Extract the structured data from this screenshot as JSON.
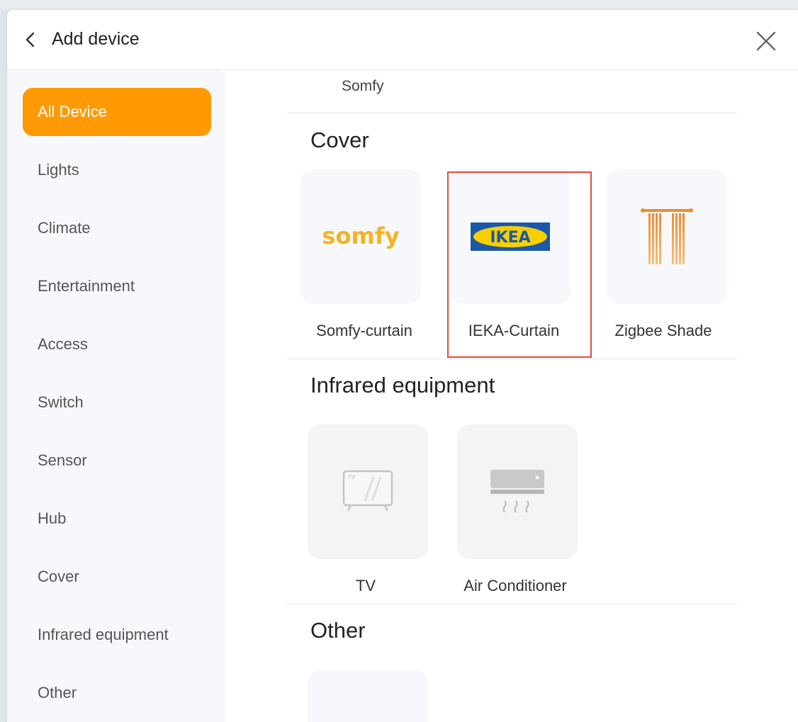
{
  "dialog": {
    "title": "Add device"
  },
  "sidebar": {
    "items": [
      {
        "label": "All Device",
        "active": true
      },
      {
        "label": "Lights"
      },
      {
        "label": "Climate"
      },
      {
        "label": "Entertainment"
      },
      {
        "label": "Access"
      },
      {
        "label": "Switch"
      },
      {
        "label": "Sensor"
      },
      {
        "label": "Hub"
      },
      {
        "label": "Cover"
      },
      {
        "label": "Infrared equipment"
      },
      {
        "label": "Other"
      }
    ]
  },
  "content": {
    "top_item_label": "Somfy",
    "sections": [
      {
        "title": "Cover",
        "devices": [
          {
            "label": "Somfy-curtain",
            "logo_text": "somfy",
            "icon": "somfy-logo"
          },
          {
            "label": "IEKA-Curtain",
            "logo_text": "IKEA",
            "icon": "ikea-logo",
            "highlighted": true
          },
          {
            "label": "Zigbee Shade",
            "icon": "curtain-icon"
          }
        ]
      },
      {
        "title": "Infrared equipment",
        "devices": [
          {
            "label": "TV",
            "tv_badge": "TV",
            "icon": "tv-icon"
          },
          {
            "label": "Air Conditioner",
            "icon": "air-conditioner-icon"
          }
        ]
      },
      {
        "title": "Other",
        "devices": []
      }
    ]
  },
  "colors": {
    "accent": "#ff9a04",
    "highlight": "#e34b3c",
    "ikea_blue": "#1a58a8",
    "ikea_yellow": "#f8d000",
    "somfy": "#f4b322"
  }
}
